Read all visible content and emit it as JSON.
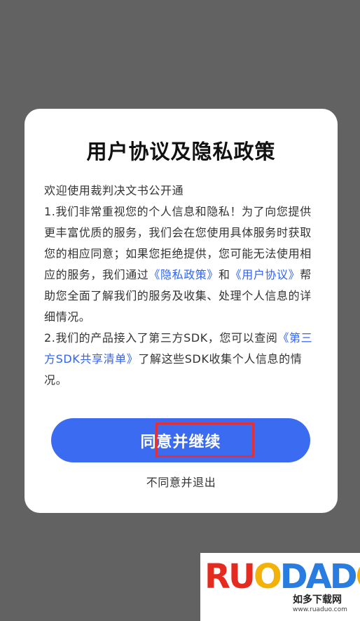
{
  "dialog": {
    "title": "用户协议及隐私政策",
    "welcome": "欢迎使用裁判决文书公开通",
    "p1_before": "1.我们非常重视您的个人信息和隐私！为了向您提供更丰富优质的服务，我们会在您使用具体服务时获取您的相应同意；如果您拒绝提供，您可能无法使用相应的服务，我们通过",
    "p1_link_privacy": "《隐私政策》",
    "p1_and": "和",
    "p1_link_agreement": "《用户协议》",
    "p1_after": "帮助您全面了解我们的服务及收集、处理个人信息的详细情况。",
    "p2_before": "2.我们的产品接入了第三方SDK，您可以查阅",
    "p2_link": "《第三方SDK共享清单》",
    "p2_after": "了解这些SDK收集个人信息的情况。",
    "agree_label": "同意并继续",
    "decline_label": "不同意并退出"
  },
  "watermark": {
    "logo_r": "R",
    "logo_u": "U",
    "logo_o": "O",
    "logo_d": "D",
    "logo_a": "A",
    "logo_d2": "D",
    "logo_o2": "O",
    "cn_name": "如多下载网",
    "url": "www.ruaduo.com"
  },
  "colors": {
    "overlay": "#626262",
    "accent_blue": "#3a6bf0",
    "link_blue": "#2f63f0",
    "highlight_red": "#e0303a"
  }
}
